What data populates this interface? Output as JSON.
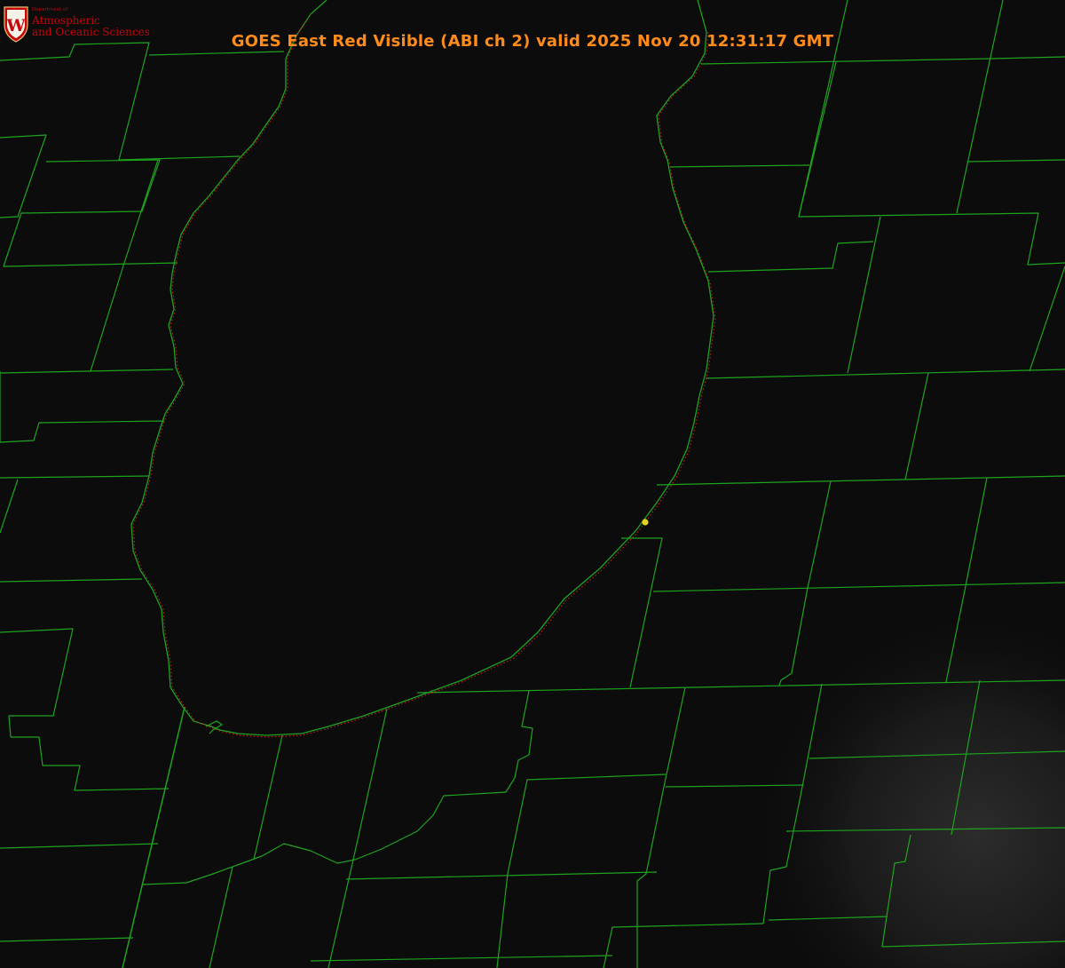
{
  "title": "GOES East Red Visible (ABI ch 2) valid 2025 Nov 20 12:31:17 GMT",
  "logo": {
    "department": "Department of",
    "line1": "Atmospheric",
    "line2": "and Oceanic Sciences",
    "shield_letter": "W"
  },
  "colors": {
    "background": "#0c0c0c",
    "title": "#ff8c1a",
    "boundary": "#1fa31f",
    "shoreline_dots": "#d42020",
    "marker": "#e8d21c",
    "logo_text": "#c5050c",
    "shield": "#c5050c"
  }
}
